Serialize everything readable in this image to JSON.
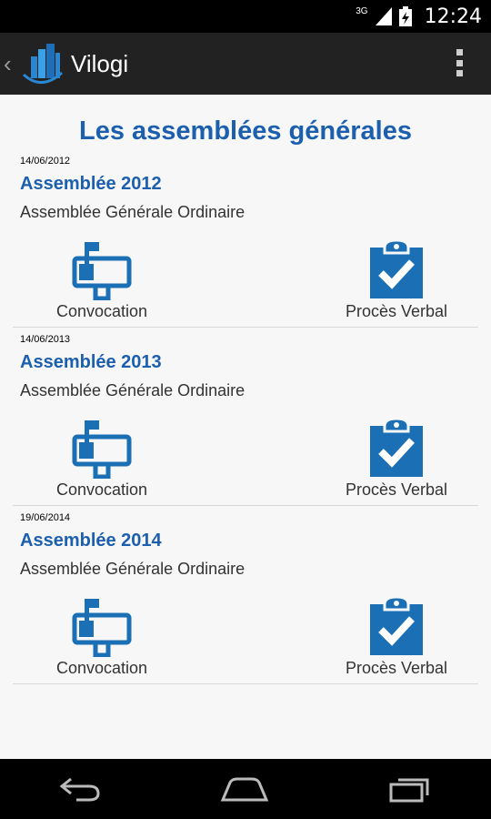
{
  "status_bar": {
    "network": "3G",
    "time": "12:24"
  },
  "app_bar": {
    "title": "Vilogi"
  },
  "page_title": "Les assemblées générales",
  "accent_color": "#1b5fae",
  "assemblies": [
    {
      "date": "14/06/2012",
      "name": "Assemblée 2012",
      "type": "Assemblée Générale Ordinaire",
      "convocation_label": "Convocation",
      "pv_label": "Procès Verbal"
    },
    {
      "date": "14/06/2013",
      "name": "Assemblée 2013",
      "type": "Assemblée Générale Ordinaire",
      "convocation_label": "Convocation",
      "pv_label": "Procès Verbal"
    },
    {
      "date": "19/06/2014",
      "name": "Assemblée 2014",
      "type": "Assemblée Générale Ordinaire",
      "convocation_label": "Convocation",
      "pv_label": "Procès Verbal"
    }
  ],
  "icons": {
    "convocation": "mailbox-icon",
    "pv": "clipboard-check-icon",
    "nav": [
      "back-icon",
      "home-icon",
      "recent-apps-icon"
    ]
  }
}
